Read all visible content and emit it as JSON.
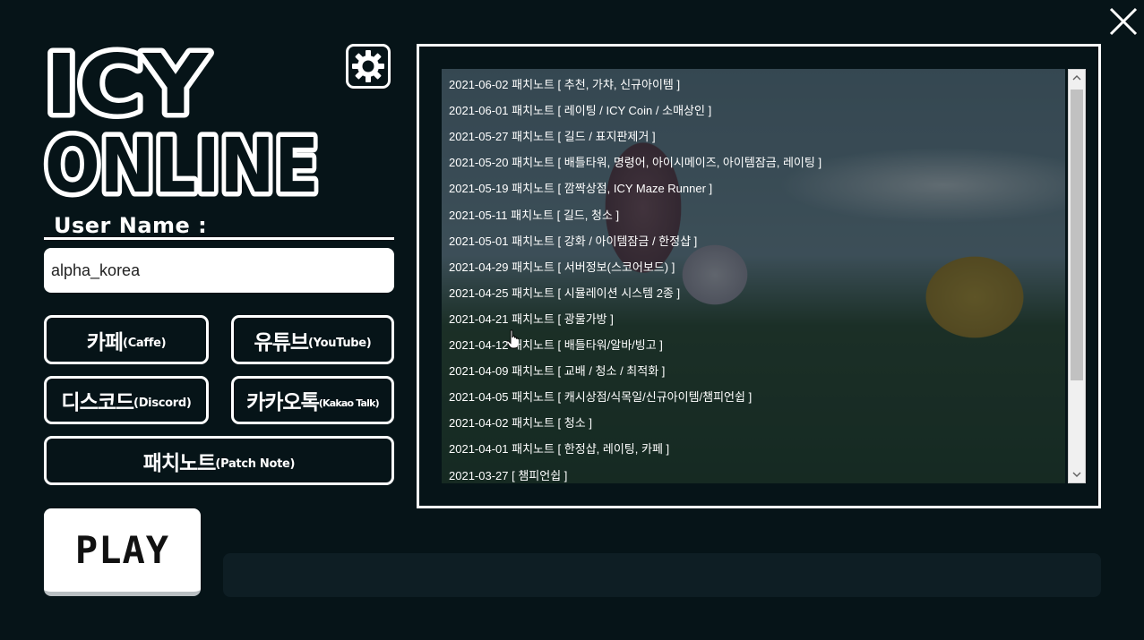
{
  "app": {
    "logo_line1": "ICY",
    "logo_line2": "ONLINE"
  },
  "login": {
    "label": "User Name :",
    "username_value": "alpha_korea"
  },
  "links": {
    "cafe": {
      "main": "카페",
      "sub": "(Caffe)"
    },
    "youtube": {
      "main": "유튜브",
      "sub": "(YouTube)"
    },
    "discord": {
      "main": "디스코드",
      "sub": "(Discord)"
    },
    "kakao": {
      "main": "카카오톡",
      "sub": "(Kakao Talk)"
    },
    "patch": {
      "main": "패치노트",
      "sub": "(Patch Note)"
    }
  },
  "play": {
    "label": "PLAY"
  },
  "patch_notes": [
    "2021-06-02 패치노트 [ 추천, 가챠, 신규아이템 ]",
    "2021-06-01 패치노트 [ 레이팅 / ICY Coin / 소매상인 ]",
    "2021-05-27 패치노트 [ 길드 / 표지판제거 ]",
    "2021-05-20 패치노트 [ 배틀타워, 명령어, 아이시메이즈, 아이템잠금, 레이팅 ]",
    "2021-05-19 패치노트 [ 깜짝상점, ICY Maze Runner ]",
    "2021-05-11 패치노트 [ 길드, 청소 ]",
    "2021-05-01 패치노트 [ 강화 / 아이템잠금 / 한정샵 ]",
    "2021-04-29 패치노트 [ 서버정보(스코어보드) ]",
    "2021-04-25 패치노트 [ 시뮬레이션 시스템 2종 ]",
    "2021-04-21 패치노트 [ 광물가방 ]",
    "2021-04-12 패치노트 [ 배틀타워/알바/빙고 ]",
    "2021-04-09 패치노트 [ 교배 / 청소 / 최적화 ]",
    "2021-04-05 패치노트 [ 캐시상점/식목일/신규아이템/챔피언쉽 ]",
    "2021-04-02 패치노트 [ 청소 ]",
    "2021-04-01 패치노트 [ 한정샵, 레이팅, 카페 ]",
    "2021-03-27 [ 챔피언쉽 ]"
  ],
  "icons": {
    "close": "close-icon",
    "settings": "gear-icon",
    "scroll_up": "chevron-up-icon",
    "scroll_down": "chevron-down-icon"
  },
  "colors": {
    "background": "#061418",
    "foreground": "#ffffff",
    "status_bar": "#0e1e24"
  }
}
